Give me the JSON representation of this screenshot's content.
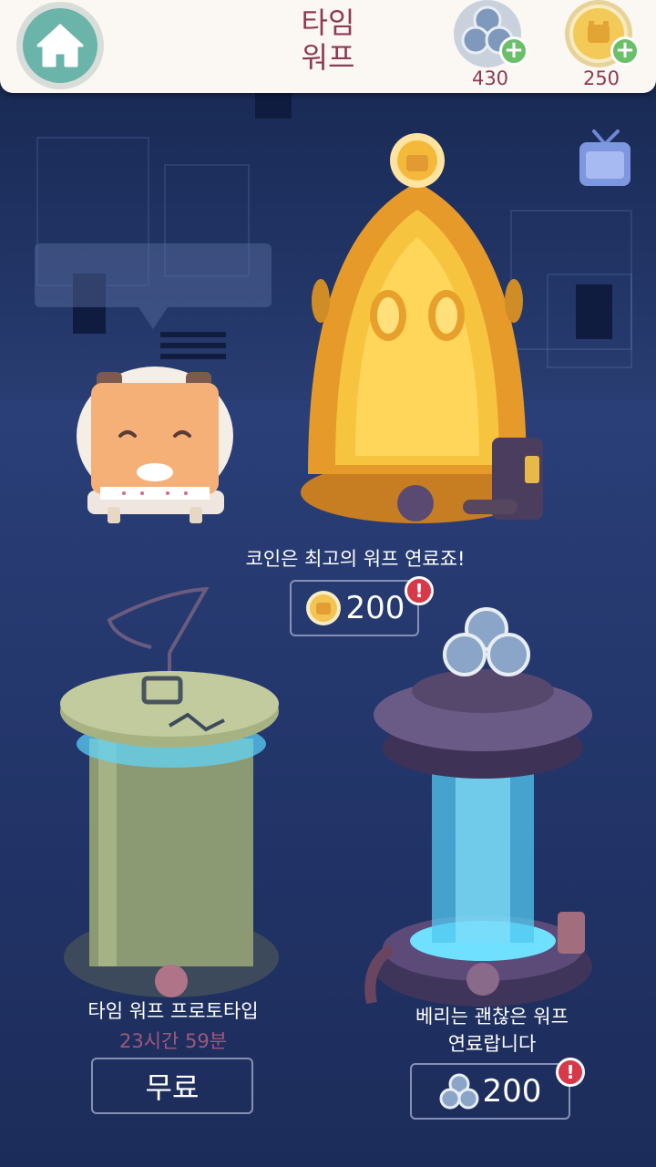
{
  "header": {
    "title_line1": "타임",
    "title_line2": "워프",
    "berries_amount": "430",
    "coins_amount": "250"
  },
  "warp_machine": {
    "caption": "코인은 최고의 워프 연료죠!",
    "price": "200",
    "alert": "!"
  },
  "prototype": {
    "caption": "타임 워프 프로토타입",
    "timer": "23시간 59분",
    "button_label": "무료"
  },
  "berry_machine": {
    "caption_line1": "베리는 괜찮은 워프",
    "caption_line2": "연료랍니다",
    "price": "200",
    "alert": "!"
  },
  "colors": {
    "accent": "#8e3a55",
    "home": "#6bb4a9",
    "alert": "#d8394a",
    "plus": "#6bbf6a"
  }
}
